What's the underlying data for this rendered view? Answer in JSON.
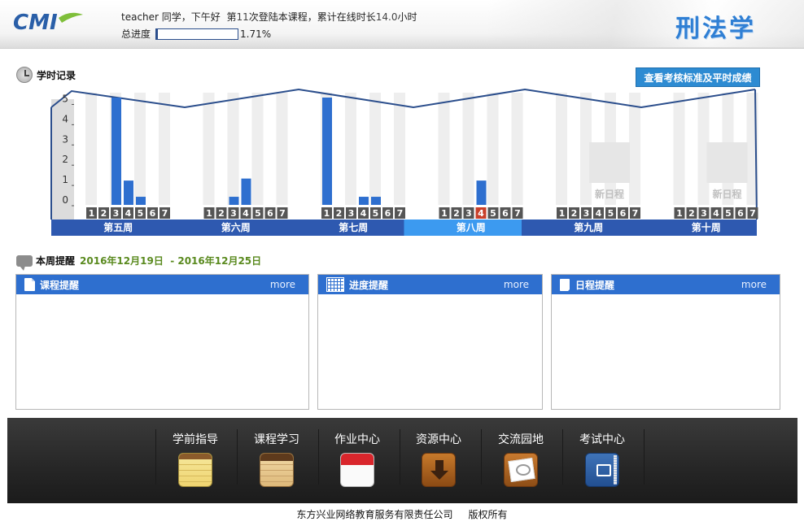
{
  "header": {
    "logo_text": "CMI",
    "greeting": {
      "user": "teacher",
      "salutation": "同学，下午好",
      "login_prefix": "第",
      "login_count": "11",
      "login_suffix": "次登陆本课程，累计在线时长",
      "online_hours": "14.0",
      "online_suffix": "小时"
    },
    "progress_label": "总进度",
    "progress_value": "1.71%",
    "progress_fraction": 0.0171,
    "course_title": "刑法学"
  },
  "study_record": {
    "title": "学时记录",
    "standard_button": "查看考核标准及平时成绩"
  },
  "chart_data": {
    "type": "bar",
    "y_ticks": [
      "0",
      "1",
      "2",
      "3",
      "4",
      "5"
    ],
    "ylim": [
      0,
      5.3
    ],
    "weeks": [
      {
        "label": "第五周",
        "days": [
          "1",
          "2",
          "3",
          "4",
          "5",
          "6",
          "7"
        ],
        "values": [
          0,
          0,
          5.8,
          1.2,
          0.4,
          0,
          0
        ],
        "empty_label": ""
      },
      {
        "label": "第六周",
        "days": [
          "1",
          "2",
          "3",
          "4",
          "5",
          "6",
          "7"
        ],
        "values": [
          0,
          0,
          0.4,
          1.3,
          0,
          0,
          0
        ],
        "empty_label": ""
      },
      {
        "label": "第七周",
        "days": [
          "1",
          "2",
          "3",
          "4",
          "5",
          "6",
          "7"
        ],
        "values": [
          5.9,
          0,
          0,
          0.4,
          0.4,
          0,
          0
        ],
        "empty_label": ""
      },
      {
        "label": "第八周",
        "days": [
          "1",
          "2",
          "3",
          "4",
          "5",
          "6",
          "7"
        ],
        "values": [
          0,
          0,
          0,
          1.2,
          0,
          0,
          0
        ],
        "empty_label": "",
        "current": true,
        "today_index": 3
      },
      {
        "label": "第九周",
        "days": [
          "1",
          "2",
          "3",
          "4",
          "5",
          "6",
          "7"
        ],
        "values": [
          0,
          0,
          0,
          0,
          0,
          0,
          0
        ],
        "empty_label": "新日程"
      },
      {
        "label": "第十周",
        "days": [
          "1",
          "2",
          "3",
          "4",
          "5",
          "6",
          "7"
        ],
        "values": [
          0,
          0,
          0,
          0,
          0,
          0,
          0
        ],
        "empty_label": "新日程"
      }
    ],
    "colors": {
      "bar": "#2e6fcf",
      "axis": "#2b4e8c",
      "week_band": "#2e59b0",
      "current_week": "#3c9af0",
      "today": "#c8402b"
    }
  },
  "weekly": {
    "title": "本周提醒",
    "range_start": "2016年12月19日",
    "range_sep": "-",
    "range_end": "2016年12月25日"
  },
  "panels": [
    {
      "title": "课程提醒",
      "more": "more",
      "icon": "document-icon"
    },
    {
      "title": "进度提醒",
      "more": "more",
      "icon": "calendar-grid-icon"
    },
    {
      "title": "日程提醒",
      "more": "more",
      "icon": "note-icon"
    }
  ],
  "nav": [
    {
      "label": "学前指导",
      "icon": "notepad-icon"
    },
    {
      "label": "课程学习",
      "icon": "notebook-icon"
    },
    {
      "label": "作业中心",
      "icon": "calendar-icon"
    },
    {
      "label": "资源中心",
      "icon": "download-icon"
    },
    {
      "label": "交流园地",
      "icon": "chat-icon"
    },
    {
      "label": "考试中心",
      "icon": "book-icon"
    }
  ],
  "footer": {
    "company": "东方兴业网络教育服务有限责任公司",
    "rights": "版权所有"
  }
}
